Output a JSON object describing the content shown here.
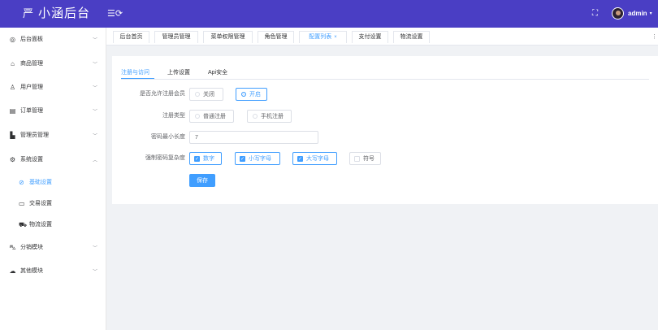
{
  "header": {
    "logo_mark": "严",
    "title": "小涵后台",
    "collapse_icon": "menu-fold-icon",
    "fullscreen_icon": "fullscreen-icon",
    "username": "admin",
    "user_caret": "▾"
  },
  "sidebar": {
    "items": [
      {
        "label": "后台面板",
        "icon": "dashboard-icon"
      },
      {
        "label": "商品管理",
        "icon": "shop-icon"
      },
      {
        "label": "用户管理",
        "icon": "user-icon"
      },
      {
        "label": "订单管理",
        "icon": "order-icon"
      },
      {
        "label": "管理员管理",
        "icon": "admin-icon"
      },
      {
        "label": "系统设置",
        "icon": "settings-icon"
      },
      {
        "label": "分销模块",
        "icon": "cart-icon"
      },
      {
        "label": "其他模块",
        "icon": "cloud-icon"
      }
    ],
    "sub_items": [
      {
        "label": "基础设置",
        "icon": "globe-icon"
      },
      {
        "label": "交易设置",
        "icon": "card-icon"
      },
      {
        "label": "物流设置",
        "icon": "truck-icon"
      }
    ]
  },
  "tabs": [
    {
      "label": "后台首页"
    },
    {
      "label": "管理员管理"
    },
    {
      "label": "菜单权限管理"
    },
    {
      "label": "角色管理"
    },
    {
      "label": "配置列表"
    },
    {
      "label": "支付设置"
    },
    {
      "label": "物流设置"
    }
  ],
  "tab_close": "×",
  "tabs_scroll_icon": "more-vertical-icon",
  "settings": {
    "inner_tabs": [
      {
        "label": "注册与访问"
      },
      {
        "label": "上传设置"
      },
      {
        "label": "Api安全"
      }
    ],
    "allow_register": {
      "label": "是否允许注册会员",
      "options": [
        "关闭",
        "开启"
      ],
      "selected": "开启"
    },
    "register_type": {
      "label": "注册类型",
      "options": [
        "普通注册",
        "手机注册"
      ],
      "selected": null
    },
    "password_min_length": {
      "label": "密码最小长度",
      "value": "7"
    },
    "password_complexity": {
      "label": "强制密码复杂度",
      "options": [
        {
          "label": "数字",
          "checked": true
        },
        {
          "label": "小写字母",
          "checked": true
        },
        {
          "label": "大写字母",
          "checked": true
        },
        {
          "label": "符号",
          "checked": false
        }
      ]
    },
    "save_label": "保存"
  },
  "colors": {
    "header_bg": "#4a3ec4",
    "primary": "#409eff",
    "page_bg": "#f0f2f5"
  }
}
